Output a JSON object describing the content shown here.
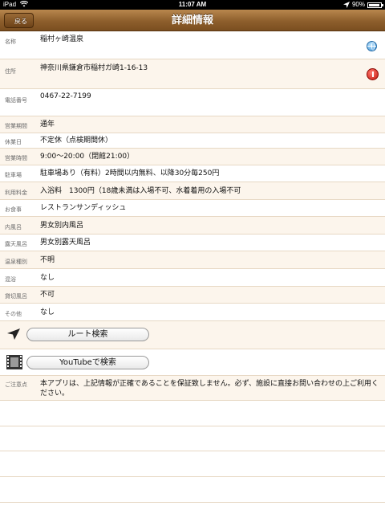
{
  "status_bar": {
    "carrier": "iPad",
    "time": "11:07 AM",
    "battery": "90%"
  },
  "nav": {
    "back_label": "戻る",
    "title": "詳細情報"
  },
  "details": [
    {
      "label": "名称",
      "value": "稲村ヶ崎温泉",
      "icon": "globe-icon"
    },
    {
      "label": "住所",
      "value": "神奈川県鎌倉市稲村ガ崎1-16-13",
      "icon": "map-pin-icon"
    },
    {
      "label": "電話番号",
      "value": "0467-22-7199"
    },
    {
      "label": "営業期間",
      "value": "通年"
    },
    {
      "label": "休業日",
      "value": "不定休（点検期間休）"
    },
    {
      "label": "営業時間",
      "value": "9:00～20:00（閉館21:00）"
    },
    {
      "label": "駐車場",
      "value": "駐車場あり（有料）2時間以内無料、以降30分毎250円"
    },
    {
      "label": "利用料金",
      "value": "入浴料　1300円（18歳未満は入場不可、水着着用の入場不可"
    },
    {
      "label": "お食事",
      "value": "レストランサンディッシュ"
    },
    {
      "label": "内風呂",
      "value": "男女別内風呂"
    },
    {
      "label": "露天風呂",
      "value": "男女別露天風呂"
    },
    {
      "label": "温泉種別",
      "value": "不明"
    },
    {
      "label": "混浴",
      "value": "なし"
    },
    {
      "label": "貸切風呂",
      "value": "不可"
    },
    {
      "label": "その他",
      "value": "なし"
    }
  ],
  "actions": {
    "route_label": "ルート検索",
    "youtube_label": "YouTubeで検索"
  },
  "notice": {
    "label": "ご注意点",
    "text": "本アプリは、上記情報が正確であることを保証致しません。必ず、施設に直接お問い合わせの上ご利用ください。"
  },
  "colors": {
    "nav_bar": "#8e5f2c",
    "row_alt": "#fcf5ec",
    "divider": "#e7d8c4"
  }
}
